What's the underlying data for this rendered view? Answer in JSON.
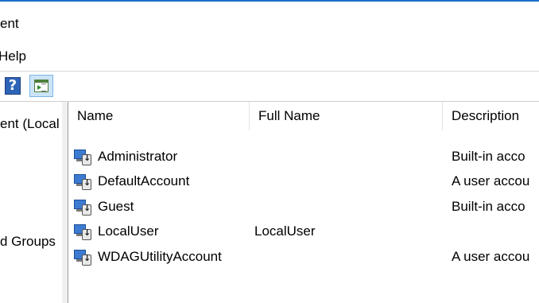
{
  "window": {
    "title": "ent"
  },
  "menubar": {
    "help_label": "Help",
    "help_visible": "Help"
  },
  "toolbar": {
    "help_glyph": "?",
    "help_icon": "help-icon",
    "action_icon": "show-action-pane-icon"
  },
  "tree": {
    "items": [
      {
        "label": "ent (Local"
      },
      {
        "label": "d Groups"
      }
    ]
  },
  "list": {
    "columns": [
      "Name",
      "Full Name",
      "Description"
    ],
    "rows": [
      {
        "name": "Administrator",
        "full_name": "",
        "description": "Built-in acco"
      },
      {
        "name": "DefaultAccount",
        "full_name": "",
        "description": "A user accou"
      },
      {
        "name": "Guest",
        "full_name": "",
        "description": "Built-in acco"
      },
      {
        "name": "LocalUser",
        "full_name": "LocalUser",
        "description": ""
      },
      {
        "name": "WDAGUtilityAccount",
        "full_name": "",
        "description": "A user accou"
      }
    ]
  },
  "colors": {
    "accent": "#1e6fc9",
    "selected_button_bg": "#cce4f7"
  }
}
